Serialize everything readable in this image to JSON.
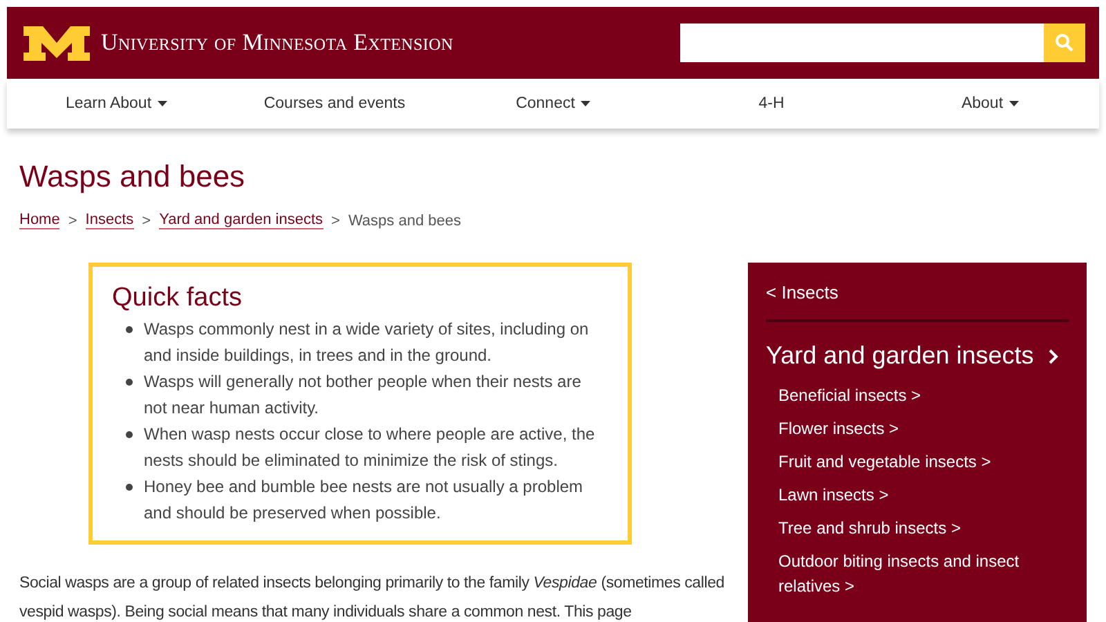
{
  "header": {
    "logo_text": "University of Minnesota Extension"
  },
  "nav": [
    {
      "label": "Learn About",
      "kind": "dropdown"
    },
    {
      "label": "Courses and events",
      "kind": "link"
    },
    {
      "label": "Connect",
      "kind": "dropdown"
    },
    {
      "label": "4-H",
      "kind": "link"
    },
    {
      "label": "About",
      "kind": "dropdown"
    }
  ],
  "page_title": "Wasps and bees",
  "breadcrumb_separator": ">",
  "breadcrumb": [
    {
      "label": "Home",
      "kind": "link"
    },
    {
      "label": "Insects",
      "kind": "link"
    },
    {
      "label": "Yard and garden insects",
      "kind": "link"
    },
    {
      "label": "Wasps and bees",
      "kind": "current"
    }
  ],
  "quick_facts": {
    "title": "Quick facts",
    "items": [
      "Wasps commonly nest in a wide variety of sites, including on and inside buildings, in trees and in the ground.",
      "Wasps will generally not bother people when their nests are not near human activity.",
      "When wasp nests occur close to where people are active, the nests should be eliminated to minimize the risk of stings.",
      "Honey bee and bumble bee nests are not usually a problem and should be preserved when possible."
    ]
  },
  "body_text": "Social wasps are a group of related insects belonging primarily to the family *Vespidae* (sometimes called vespid wasps). Being social means that many individuals share a common nest. This page",
  "sidebar": {
    "back_link": "< Insects",
    "heading": "Yard and garden insects",
    "items": [
      "Beneficial insects >",
      "Flower insects >",
      "Fruit and vegetable insects >",
      "Lawn insects >",
      "Tree and shrub insects >",
      "Outdoor biting insects and insect relatives >"
    ]
  }
}
